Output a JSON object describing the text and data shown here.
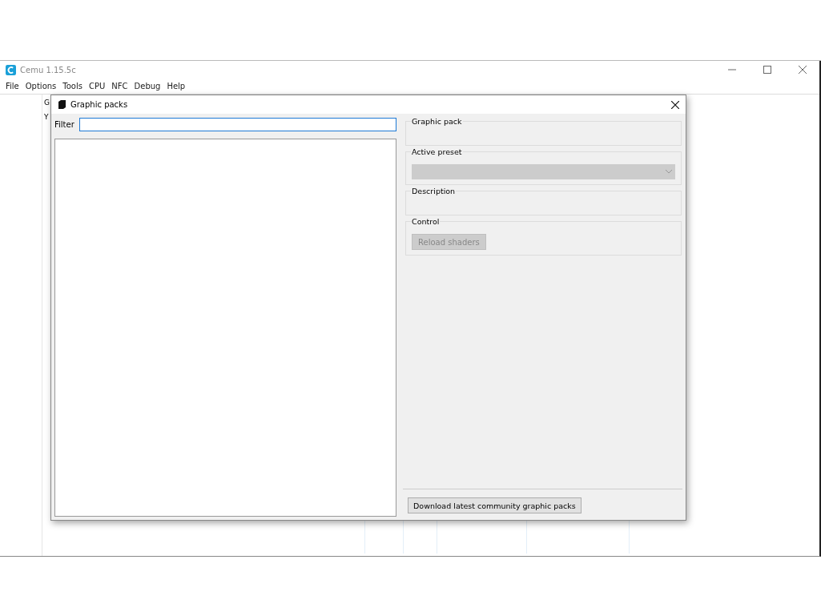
{
  "window": {
    "title": "Cemu 1.15.5c"
  },
  "menu": [
    "File",
    "Options",
    "Tools",
    "CPU",
    "NFC",
    "Debug",
    "Help"
  ],
  "behind_texts": [
    "G",
    "Y"
  ],
  "dialog": {
    "title": "Graphic packs",
    "filter": {
      "label": "Filter"
    },
    "groups": [
      {
        "kind": "empty",
        "label": "Graphic pack"
      },
      {
        "kind": "dropdown",
        "label": "Active preset",
        "disabled": true
      },
      {
        "kind": "empty",
        "label": "Description"
      },
      {
        "kind": "button",
        "label": "Control",
        "button": "Reload shaders",
        "disabled": true
      }
    ],
    "download_button": "Download latest community graphic packs"
  }
}
